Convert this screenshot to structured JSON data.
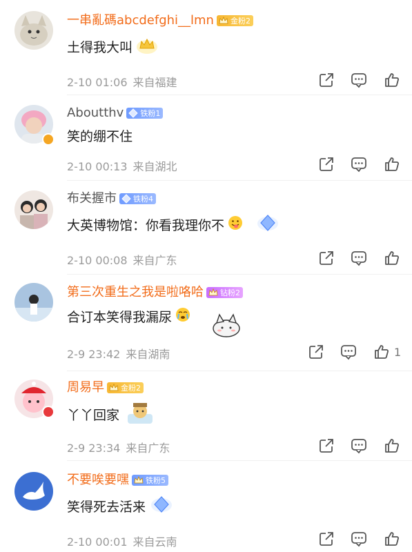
{
  "comments": [
    {
      "user": "一串亂碼abcdefghi__lmn",
      "badge": "金粉2",
      "badge_type": "gold",
      "text": "土得我大叫",
      "date": "2-10 01:06",
      "location": "来自福建",
      "likes": ""
    },
    {
      "user": "Aboutthv",
      "badge": "铁粉1",
      "badge_type": "iron",
      "text": "笑的绷不住",
      "date": "2-10 00:13",
      "location": "来自湖北",
      "likes": ""
    },
    {
      "user": "布关握市",
      "badge": "铁粉4",
      "badge_type": "iron",
      "text": "大英博物馆：你看我理你不",
      "date": "2-10 00:08",
      "location": "来自广东",
      "likes": ""
    },
    {
      "user": "第三次重生之我是啦咯哈",
      "badge": "钻粉2",
      "badge_type": "diamond",
      "text": "合订本笑得我漏尿",
      "date": "2-9 23:42",
      "location": "来自湖南",
      "likes": "1"
    },
    {
      "user": "周易早",
      "badge": "金粉2",
      "badge_type": "gold",
      "text": "丫丫回家",
      "date": "2-9 23:34",
      "location": "来自广东",
      "likes": ""
    },
    {
      "user": "不要唉要嘿",
      "badge": "铁粉5",
      "badge_type": "iron",
      "text": "笑得死去活来",
      "date": "2-10 00:01",
      "location": "来自云南",
      "likes": ""
    }
  ],
  "icons": {
    "share": "share-icon",
    "comment": "comment-icon",
    "like": "like-icon"
  },
  "colors": {
    "name_orange": "#f26c1a",
    "meta_gray": "#9a9a9a",
    "text": "#222222"
  }
}
